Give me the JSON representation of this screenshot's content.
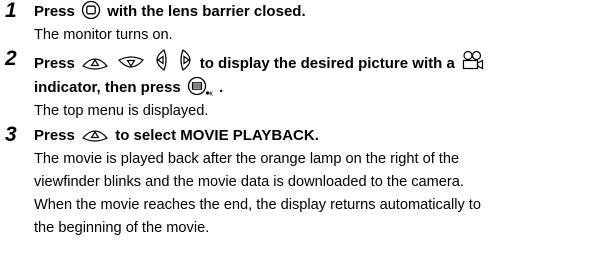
{
  "steps": [
    {
      "number": "1",
      "instruction_parts": [
        "Press",
        "with the lens barrier closed."
      ],
      "icons": [
        "monitor-button-icon"
      ],
      "description_lines": [
        "The monitor turns on."
      ]
    },
    {
      "number": "2",
      "instruction_line1_parts": [
        "Press",
        "to display the desired picture with a"
      ],
      "instruction_line2_parts": [
        "indicator, then press",
        "."
      ],
      "icons": [
        "arrow-up-button-icon",
        "arrow-down-button-icon",
        "arrow-left-button-icon",
        "arrow-right-button-icon",
        "movie-indicator-icon",
        "ok-menu-button-icon"
      ],
      "description_lines": [
        "The top menu is displayed."
      ]
    },
    {
      "number": "3",
      "instruction_parts": [
        "Press",
        "to select MOVIE PLAYBACK."
      ],
      "icons": [
        "arrow-up-button-icon"
      ],
      "description_lines": [
        "The movie is played back after the orange lamp on the right of the",
        "viewfinder blinks and the movie data is downloaded to the camera.",
        "When the movie reaches the end, the display returns automatically to",
        "the beginning of the movie."
      ]
    }
  ]
}
